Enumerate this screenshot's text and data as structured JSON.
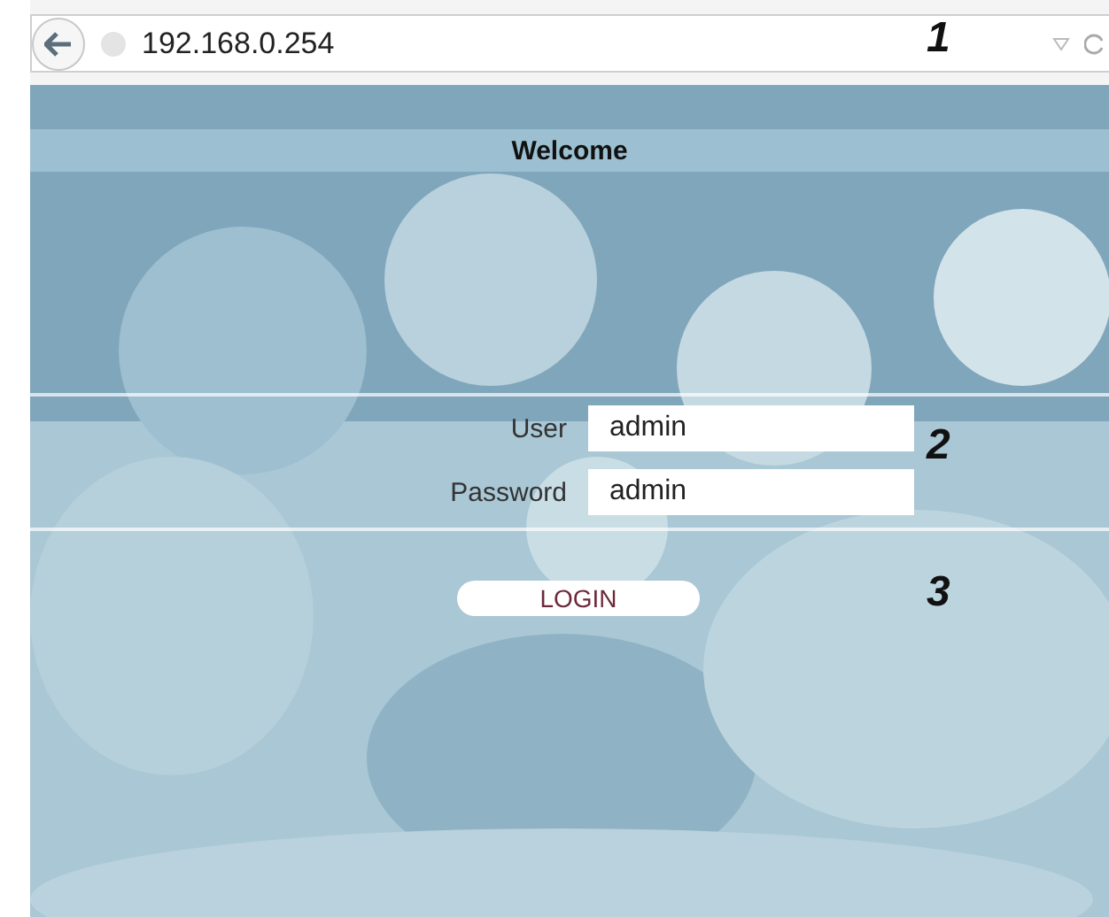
{
  "address_bar": {
    "url": "192.168.0.254"
  },
  "page": {
    "kind": "picture",
    "title": "Welcome",
    "fields": [
      {
        "label": "User",
        "value": "admin"
      },
      {
        "label": "Password",
        "value": "admin"
      }
    ],
    "login_button": "LOGIN"
  },
  "callouts": [
    "1",
    "2",
    "3"
  ]
}
